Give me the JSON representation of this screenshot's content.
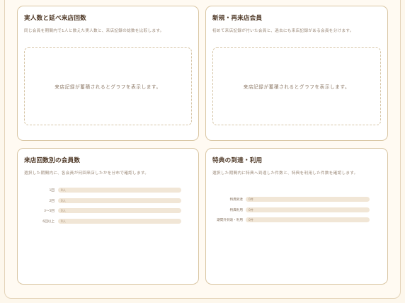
{
  "cards": {
    "visits": {
      "title": "実人数と延べ来店回数",
      "description": "同じ会員を期間内で1人と数えた実人数と、来店記録の総数を比較します。",
      "placeholder": "来店記録が蓄積されるとグラフを表示します。"
    },
    "new_returning": {
      "title": "新規・再来店会員",
      "description": "初めて来店記録が付いた会員と、過去にも来店記録がある会員を分けます。",
      "placeholder": "来店記録が蓄積されるとグラフを表示します。"
    },
    "visit_count": {
      "title": "来店回数別の会員数",
      "description": "選択した期間内に、各会員が何回来店したかを分布で確認します。",
      "rows": [
        {
          "label": "1回",
          "value": "0人",
          "fraction": 0
        },
        {
          "label": "2回",
          "value": "0人",
          "fraction": 0
        },
        {
          "label": "3〜5回",
          "value": "0人",
          "fraction": 0
        },
        {
          "label": "6回以上",
          "value": "0人",
          "fraction": 0
        }
      ]
    },
    "benefits": {
      "title": "特典の到達・利用",
      "description": "選択した期間内に特典へ到達した件数と、特典を利用した件数を確認します。",
      "rows": [
        {
          "label": "特典到達",
          "value": "0件",
          "fraction": 0
        },
        {
          "label": "特典利用",
          "value": "0件",
          "fraction": 0
        },
        {
          "label": "期間外到達・利用",
          "value": "0件",
          "fraction": 0
        }
      ]
    }
  }
}
